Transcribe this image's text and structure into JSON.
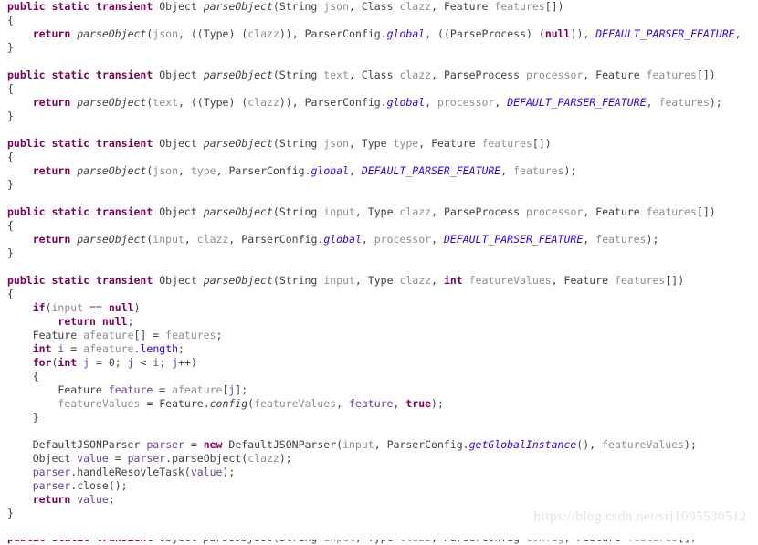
{
  "editor": {
    "language": "Java",
    "background": "#ffffff",
    "colors": {
      "keyword": "#7f0055",
      "type": "#3f3f3f",
      "parameter": "#8e8e8e",
      "local_variable": "#6a3ea1",
      "static_field": "#2a00ff",
      "method_declaration": "#3f3f3f",
      "watermark": "#e2e2e2"
    }
  },
  "watermark": {
    "text": "https://blog.csdn.net/srj1095530512"
  },
  "code": {
    "lines": [
      {
        "id": 1,
        "text": "public static transient Object parseObject(String json, Class clazz, Feature features[])"
      },
      {
        "id": 2,
        "text": "{"
      },
      {
        "id": 3,
        "text": "    return parseObject(json, ((Type) (clazz)), ParserConfig.global, ((ParseProcess) (null)), DEFAULT_PARSER_FEATURE,"
      },
      {
        "id": 4,
        "text": "}"
      },
      {
        "id": 5,
        "text": ""
      },
      {
        "id": 6,
        "text": "public static transient Object parseObject(String text, Class clazz, ParseProcess processor, Feature features[])"
      },
      {
        "id": 7,
        "text": "{"
      },
      {
        "id": 8,
        "text": "    return parseObject(text, ((Type) (clazz)), ParserConfig.global, processor, DEFAULT_PARSER_FEATURE, features);"
      },
      {
        "id": 9,
        "text": "}"
      },
      {
        "id": 10,
        "text": ""
      },
      {
        "id": 11,
        "text": "public static transient Object parseObject(String json, Type type, Feature features[])"
      },
      {
        "id": 12,
        "text": "{"
      },
      {
        "id": 13,
        "text": "    return parseObject(json, type, ParserConfig.global, DEFAULT_PARSER_FEATURE, features);"
      },
      {
        "id": 14,
        "text": "}"
      },
      {
        "id": 15,
        "text": ""
      },
      {
        "id": 16,
        "text": "public static transient Object parseObject(String input, Type clazz, ParseProcess processor, Feature features[])"
      },
      {
        "id": 17,
        "text": "{"
      },
      {
        "id": 18,
        "text": "    return parseObject(input, clazz, ParserConfig.global, processor, DEFAULT_PARSER_FEATURE, features);"
      },
      {
        "id": 19,
        "text": "}"
      },
      {
        "id": 20,
        "text": ""
      },
      {
        "id": 21,
        "text": "public static transient Object parseObject(String input, Type clazz, int featureValues, Feature features[])"
      },
      {
        "id": 22,
        "text": "{"
      },
      {
        "id": 23,
        "text": "    if(input == null)"
      },
      {
        "id": 24,
        "text": "        return null;"
      },
      {
        "id": 25,
        "text": "    Feature afeature[] = features;"
      },
      {
        "id": 26,
        "text": "    int i = afeature.length;"
      },
      {
        "id": 27,
        "text": "    for(int j = 0; j < i; j++)"
      },
      {
        "id": 28,
        "text": "    {"
      },
      {
        "id": 29,
        "text": "        Feature feature = afeature[j];"
      },
      {
        "id": 30,
        "text": "        featureValues = Feature.config(featureValues, feature, true);"
      },
      {
        "id": 31,
        "text": "    }"
      },
      {
        "id": 32,
        "text": ""
      },
      {
        "id": 33,
        "text": "    DefaultJSONParser parser = new DefaultJSONParser(input, ParserConfig.getGlobalInstance(), featureValues);"
      },
      {
        "id": 34,
        "text": "    Object value = parser.parseObject(clazz);"
      },
      {
        "id": 35,
        "text": "    parser.handleResovleTask(value);"
      },
      {
        "id": 36,
        "text": "    parser.close();"
      },
      {
        "id": 37,
        "text": "    return value;"
      },
      {
        "id": 38,
        "text": "}"
      },
      {
        "id": 39,
        "text": ""
      }
    ],
    "clipped_line": {
      "id": 40,
      "text": "public static transient Object parseObject(String input, Type clazz, ParserConfig config, Feature features[])"
    }
  }
}
